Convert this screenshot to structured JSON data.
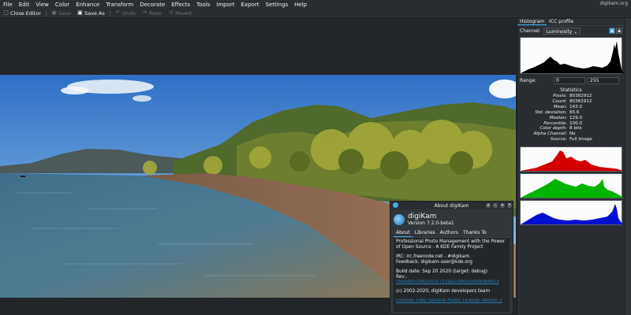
{
  "menu": {
    "items": [
      "File",
      "Edit",
      "View",
      "Color",
      "Enhance",
      "Transform",
      "Decorate",
      "Effects",
      "Tools",
      "Import",
      "Export",
      "Settings",
      "Help"
    ],
    "window_title": "digikam.org"
  },
  "toolbar": {
    "close_editor": "Close Editor",
    "save": "Save",
    "save_as": "Save As",
    "undo": "Undo",
    "redo": "Redo",
    "revert": "Revert"
  },
  "panel": {
    "tabs": [
      "Histogram",
      "ICC profile"
    ],
    "channel_label": "Channel:",
    "channel_value": "Luminosity",
    "range_label": "Range:",
    "range_min": "0",
    "range_max": "255",
    "stats_title": "Statistics",
    "stats": [
      {
        "key": "Pixels:",
        "value": "80382912"
      },
      {
        "key": "Count:",
        "value": "80382912"
      },
      {
        "key": "Mean:",
        "value": "143.0"
      },
      {
        "key": "Std. deviation:",
        "value": "65.6"
      },
      {
        "key": "Median:",
        "value": "129.0"
      },
      {
        "key": "Percentile:",
        "value": "100.0"
      },
      {
        "key": "Color depth:",
        "value": "8 bits"
      },
      {
        "key": "Alpha Channel:",
        "value": "No"
      },
      {
        "key": "Source:",
        "value": "Full Image"
      }
    ],
    "colors": {
      "red": "#d40000",
      "green": "#00b400",
      "blue": "#0010d0"
    }
  },
  "about": {
    "window_title": "About digiKam",
    "app_name": "digiKam",
    "version": "Version 7.2.0-beta1",
    "tabs": [
      "About",
      "Libraries",
      "Authors",
      "Thanks To"
    ],
    "description": "Professional Photo Management with the Power of Open Source - A KDE Family Project",
    "irc": "IRC: irc.freenode.net - #digikam",
    "feedback": "Feedback: digikam-user@kde.org",
    "build_date": "Build date: Sep 20 2020 (target: debug)",
    "rev_label": "Rev.:",
    "rev_value": "c66ede534829030733ae1cb65a59d9db6bc3",
    "copyright": "(c) 2002-2020, digiKam developers team",
    "license": "License: GNU General Public License Version 2"
  }
}
